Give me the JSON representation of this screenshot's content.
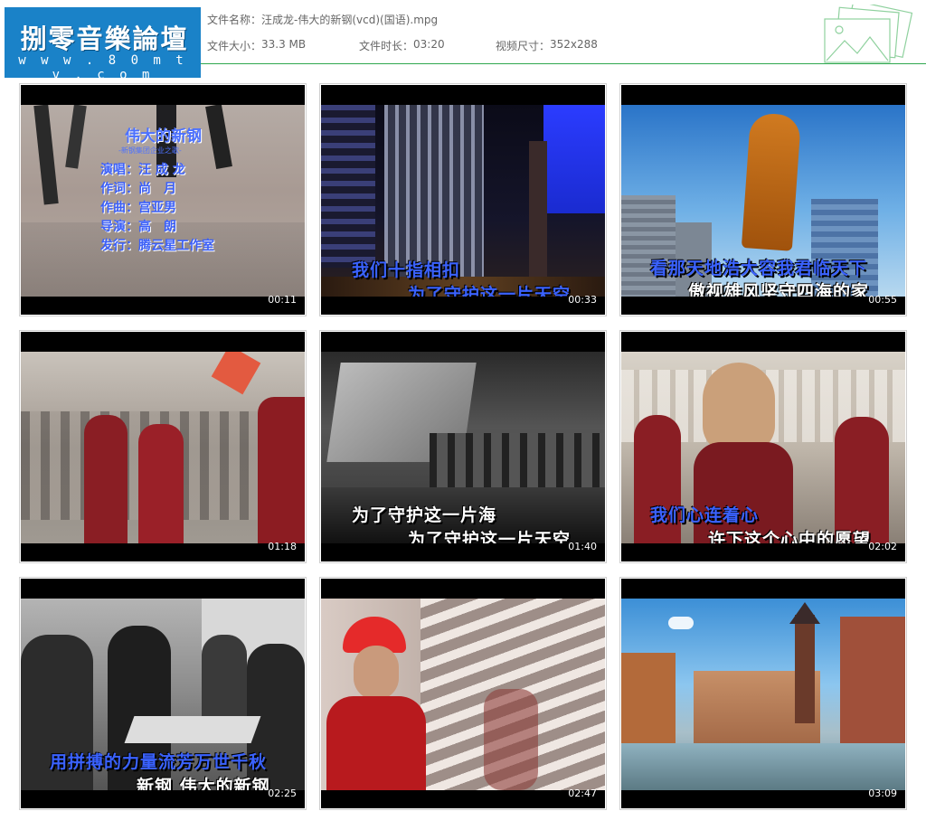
{
  "logo": {
    "name": "捌零音樂論壇",
    "url": "w w w . 8 0 m t v . c o m"
  },
  "file_info": {
    "name_label": "文件名称：",
    "name_value": "汪成龙-伟大的新钢(vcd)(国语).mpg",
    "size_label": "文件大小：",
    "size_value": "33.3 MB",
    "duration_label": "文件时长：",
    "duration_value": "03:20",
    "dimensions_label": "视频尺寸：",
    "dimensions_value": "352x288"
  },
  "colors": {
    "accent_green": "#2fa84f",
    "logo_blue": "#1a82c8",
    "subtitle_blue": "#3a62ff"
  },
  "thumbnails": [
    {
      "time": "00:11",
      "credits": {
        "title": "伟大的新钢",
        "subtitle": "-新钢集团企业之歌-",
        "lines": [
          "演唱：汪 成 龙",
          "作词：尚　月",
          "作曲：宫亚男",
          "导演：高　朗",
          "发行：腾云星工作室"
        ]
      }
    },
    {
      "time": "00:33",
      "lines": [
        "我们十指相扣",
        "为了守护这一片天空"
      ]
    },
    {
      "time": "00:55",
      "lines": [
        "看那天地浩大容我君临天下",
        "傲视雄风坚守四海的家"
      ]
    },
    {
      "time": "01:18",
      "lines": []
    },
    {
      "time": "01:40",
      "lines": [
        "为了守护这一片海",
        "为了守护这一片天空"
      ]
    },
    {
      "time": "02:02",
      "lines": [
        "我们心连着心",
        "许下这个心中的愿望"
      ]
    },
    {
      "time": "02:25",
      "lines": [
        "用拼搏的力量流芳万世千秋",
        "新钢 伟大的新钢"
      ]
    },
    {
      "time": "02:47",
      "lines": []
    },
    {
      "time": "03:09",
      "lines": []
    }
  ]
}
